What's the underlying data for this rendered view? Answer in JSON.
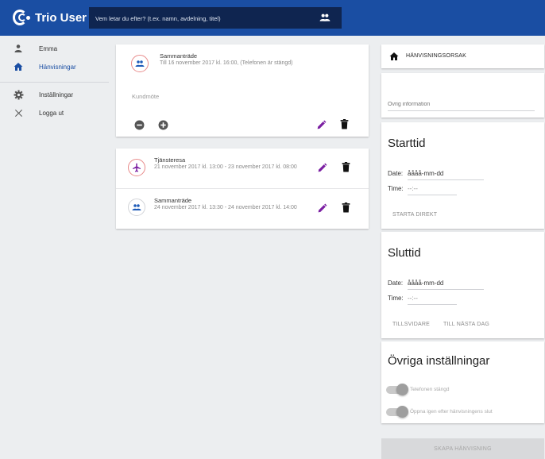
{
  "app": {
    "title": "Trio User"
  },
  "search": {
    "placeholder": "Vem letar du efter? (t.ex. namn, avdelning, titel)"
  },
  "sidebar": {
    "items": [
      {
        "label": "Emma",
        "icon": "person-icon"
      },
      {
        "label": "Hänvisningar",
        "icon": "home-icon",
        "active": true
      },
      {
        "label": "Inställningar",
        "icon": "gear-icon"
      },
      {
        "label": "Logga ut",
        "icon": "close-icon"
      }
    ]
  },
  "current_referral": {
    "title": "Sammanträde",
    "subtitle": "Till 16 november 2017 kl. 16:00, (Telefonen är stängd)",
    "note": "Kundmöte"
  },
  "scheduled": [
    {
      "title": "Tjänsteresa",
      "subtitle": "21 november 2017 kl. 13:00 - 23 november 2017 kl. 08:00",
      "icon": "airplane-icon"
    },
    {
      "title": "Sammanträde",
      "subtitle": "24 november 2017 kl. 13:30 - 24 november 2017 kl. 14:00",
      "icon": "group-icon"
    }
  ],
  "right": {
    "reason_label": "HÄNVISNINGSORSAK",
    "other_info_placeholder": "Övrig information",
    "start": {
      "title": "Starttid",
      "date_label": "Date:",
      "date_value": "åååå-mm-dd",
      "time_label": "Time:",
      "time_value": "--:--",
      "start_now": "STARTA DIREKT"
    },
    "end": {
      "title": "Sluttid",
      "date_label": "Date:",
      "date_value": "åååå-mm-dd",
      "time_label": "Time:",
      "time_value": "--:--",
      "until_further": "TILLSVIDARE",
      "until_next_day": "TILL NÄSTA DAG"
    },
    "other_settings": {
      "title": "Övriga inställningar",
      "phone_closed": "Telefonen stängd",
      "reopen_after": "Öppna igen efter hänvisningens slut"
    },
    "create_button": "SKAPA HÄNVISNING"
  },
  "colors": {
    "brand": "#1a4ea3",
    "search_bg": "#0f2550",
    "accent_purple": "#7b1fa2",
    "accent_red": "#e53935",
    "accent_blue": "#1e5bb8"
  }
}
